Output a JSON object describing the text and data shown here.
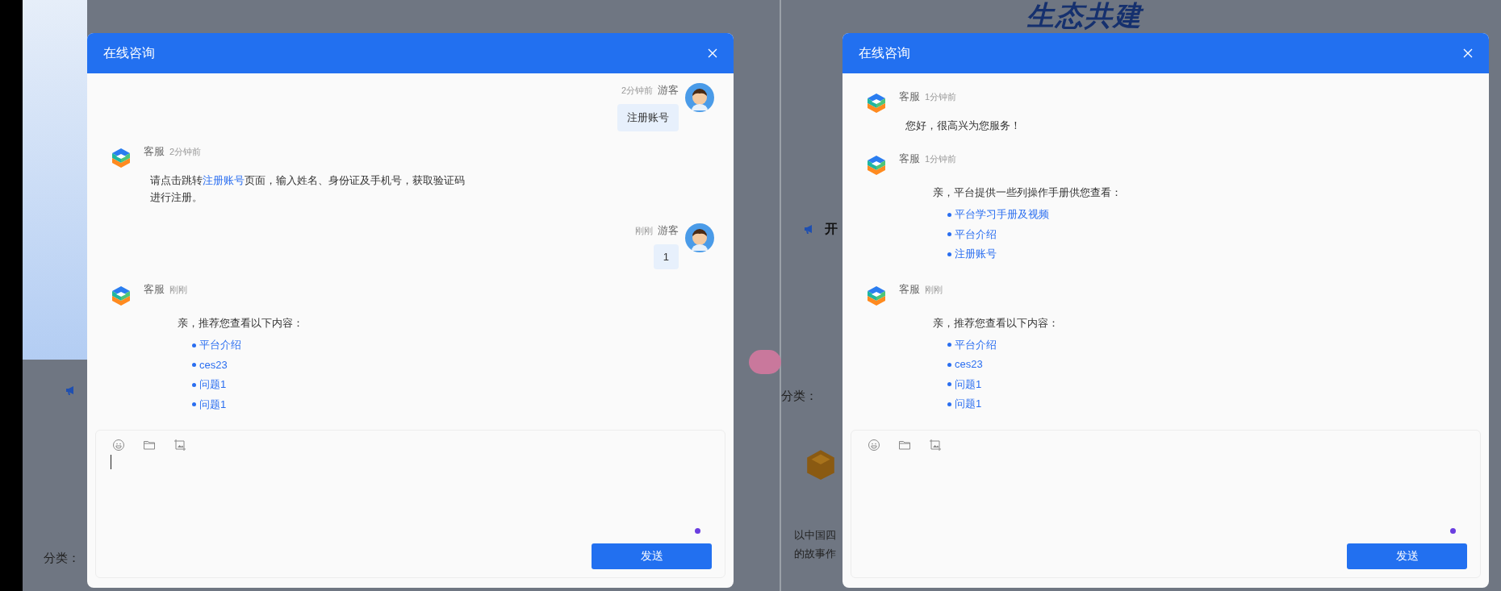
{
  "backdrop": {
    "headline": "生态共建",
    "category_labels": [
      "分类：",
      "分类："
    ],
    "card_text": [
      "以中国四",
      "的故事作"
    ],
    "fragment": "开"
  },
  "windows": [
    {
      "title": "在线咨询",
      "messages": [
        {
          "kind": "visitor",
          "time": "2分钟前",
          "name": "游客",
          "text": "注册账号"
        },
        {
          "kind": "agent_text",
          "name": "客服",
          "time": "2分钟前",
          "parts": [
            {
              "kind": "text",
              "text": "请点击跳转"
            },
            {
              "kind": "link",
              "text": "注册账号"
            },
            {
              "kind": "text",
              "text": "页面，输入姓名、身份证及手机号，获取验证码进行注册。"
            }
          ]
        },
        {
          "kind": "visitor",
          "time": "刚刚",
          "name": "游客",
          "text": "1"
        },
        {
          "kind": "agent_links",
          "name": "客服",
          "time": "刚刚",
          "intro": "亲，推荐您查看以下内容：",
          "links": [
            "平台介绍",
            "ces23",
            "问题1",
            "问题1"
          ]
        }
      ],
      "caret": true,
      "send_button": "发送"
    },
    {
      "title": "在线咨询",
      "messages": [
        {
          "kind": "agent_text",
          "name": "客服",
          "time": "1分钟前",
          "parts": [
            {
              "kind": "text",
              "text": "您好，很高兴为您服务！"
            }
          ]
        },
        {
          "kind": "agent_links",
          "name": "客服",
          "time": "1分钟前",
          "intro": "亲，平台提供一些列操作手册供您查看：",
          "links": [
            "平台学习手册及视频",
            "平台介绍",
            "注册账号"
          ]
        },
        {
          "kind": "agent_links",
          "name": "客服",
          "time": "刚刚",
          "intro": "亲，推荐您查看以下内容：",
          "links": [
            "平台介绍",
            "ces23",
            "问题1",
            "问题1"
          ]
        }
      ],
      "caret": false,
      "send_button": "发送"
    }
  ]
}
